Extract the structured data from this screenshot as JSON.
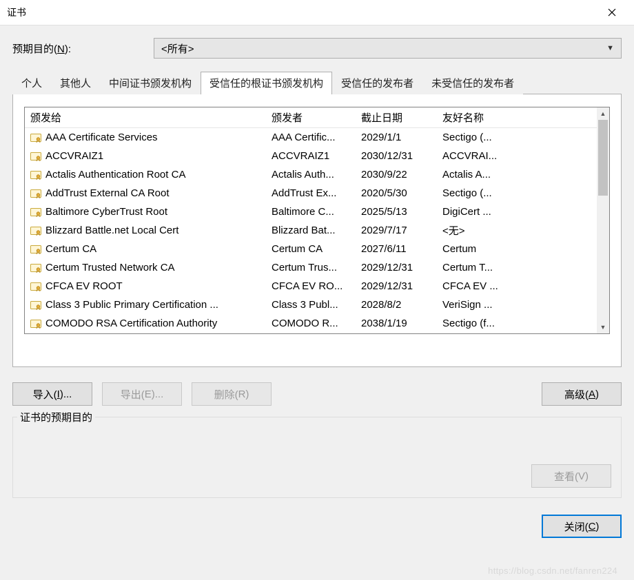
{
  "window": {
    "title": "证书"
  },
  "purpose": {
    "label_pre": "预期目的(",
    "label_u": "N",
    "label_post": "):",
    "selected": "<所有>"
  },
  "tabs": [
    {
      "label": "个人",
      "active": false
    },
    {
      "label": "其他人",
      "active": false
    },
    {
      "label": "中间证书颁发机构",
      "active": false
    },
    {
      "label": "受信任的根证书颁发机构",
      "active": true
    },
    {
      "label": "受信任的发布者",
      "active": false
    },
    {
      "label": "未受信任的发布者",
      "active": false
    }
  ],
  "columns": {
    "c1": "颁发给",
    "c2": "颁发者",
    "c3": "截止日期",
    "c4": "友好名称"
  },
  "rows": [
    {
      "to": "AAA Certificate Services",
      "by": "AAA Certific...",
      "exp": "2029/1/1",
      "name": "Sectigo (..."
    },
    {
      "to": "ACCVRAIZ1",
      "by": "ACCVRAIZ1",
      "exp": "2030/12/31",
      "name": "ACCVRAI..."
    },
    {
      "to": "Actalis Authentication Root CA",
      "by": "Actalis Auth...",
      "exp": "2030/9/22",
      "name": "Actalis A..."
    },
    {
      "to": "AddTrust External CA Root",
      "by": "AddTrust Ex...",
      "exp": "2020/5/30",
      "name": "Sectigo (..."
    },
    {
      "to": "Baltimore CyberTrust Root",
      "by": "Baltimore C...",
      "exp": "2025/5/13",
      "name": "DigiCert ..."
    },
    {
      "to": "Blizzard Battle.net Local Cert",
      "by": "Blizzard Bat...",
      "exp": "2029/7/17",
      "name": "<无>"
    },
    {
      "to": "Certum CA",
      "by": "Certum CA",
      "exp": "2027/6/11",
      "name": "Certum"
    },
    {
      "to": "Certum Trusted Network CA",
      "by": "Certum Trus...",
      "exp": "2029/12/31",
      "name": "Certum T..."
    },
    {
      "to": "CFCA EV ROOT",
      "by": "CFCA EV RO...",
      "exp": "2029/12/31",
      "name": "CFCA EV ..."
    },
    {
      "to": "Class 3 Public Primary Certification ...",
      "by": "Class 3 Publ...",
      "exp": "2028/8/2",
      "name": "VeriSign ..."
    },
    {
      "to": "COMODO RSA Certification Authority",
      "by": "COMODO R...",
      "exp": "2038/1/19",
      "name": "Sectigo (f..."
    }
  ],
  "buttons": {
    "import": {
      "pre": "导入(",
      "u": "I",
      "post": ")..."
    },
    "export": {
      "pre": "导出(",
      "u": "E",
      "post": ")..."
    },
    "delete": {
      "pre": "删除(",
      "u": "R",
      "post": ")"
    },
    "advanced": {
      "pre": "高级(",
      "u": "A",
      "post": ")"
    },
    "view": {
      "pre": "查看(",
      "u": "V",
      "post": ")"
    },
    "close": {
      "pre": "关闭(",
      "u": "C",
      "post": ")"
    }
  },
  "groupbox": {
    "label": "证书的预期目的"
  },
  "watermark": "https://blog.csdn.net/fanren224"
}
